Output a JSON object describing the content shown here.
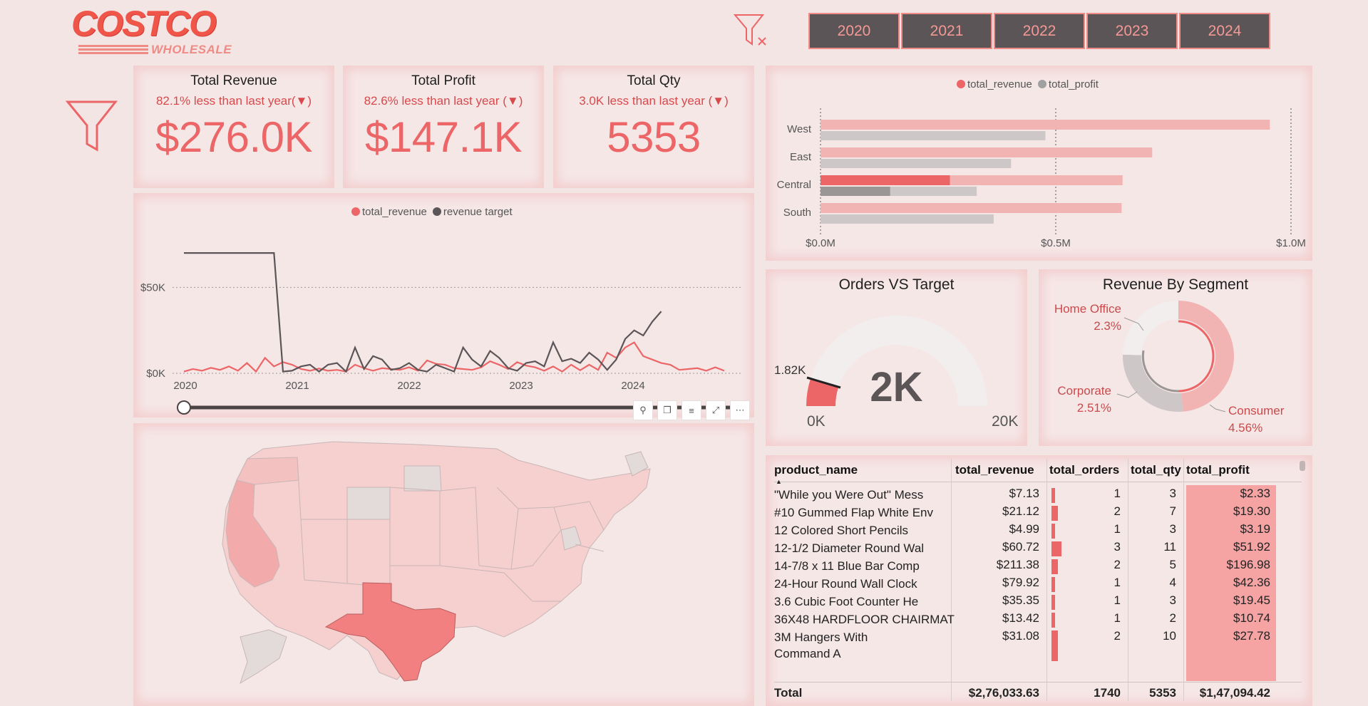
{
  "brand": {
    "name": "COSTCO",
    "sub": "WHOLESALE"
  },
  "years": [
    "2020",
    "2021",
    "2022",
    "2023",
    "2024"
  ],
  "colors": {
    "accent": "#ec6668",
    "target": "#5b5557",
    "profit": "#a0a0a0",
    "bg": "#f4e5e5"
  },
  "kpis": [
    {
      "title": "Total Revenue",
      "subtitle": "82.1% less than last year(▼)",
      "value": "$276.0K"
    },
    {
      "title": "Total Profit",
      "subtitle": "82.6% less than last year (▼)",
      "value": "$147.1K"
    },
    {
      "title": "Total Qty",
      "subtitle": "3.0K less than last year (▼)",
      "value": "5353"
    }
  ],
  "line_legend": [
    "total_revenue",
    "revenue target"
  ],
  "bar_legend": [
    "total_revenue",
    "total_profit"
  ],
  "gauge": {
    "title": "Orders VS Target",
    "value": "2K",
    "min": "0K",
    "max": "20K",
    "target": "1.82K",
    "fraction": 0.1
  },
  "donut": {
    "title": "Revenue By Segment",
    "labels": [
      {
        "name": "Home Office",
        "pct": "2.3%"
      },
      {
        "name": "Corporate",
        "pct": "2.51%"
      },
      {
        "name": "Consumer",
        "pct": "4.56%"
      }
    ]
  },
  "chart_data": [
    {
      "type": "line",
      "title": "",
      "xlabel": "",
      "ylabel": "",
      "x_ticks": [
        "2020",
        "2021",
        "2022",
        "2023",
        "2024"
      ],
      "y_ticks": [
        "$0K",
        "$50K"
      ],
      "ylim": [
        0,
        80000
      ],
      "grid": true,
      "legend": "top-center",
      "series": [
        {
          "name": "total_revenue",
          "values": [
            1000,
            2500,
            1500,
            3200,
            2000,
            4000,
            1500,
            6000,
            1000,
            9000,
            4000,
            6500,
            5000,
            2500,
            1500,
            2800,
            1500,
            2000,
            1000,
            5000,
            3000,
            1500,
            3000,
            2500,
            2000,
            3500,
            1500,
            7500,
            5500,
            5000,
            3000,
            2500,
            2000,
            3500,
            7000,
            5000,
            2500,
            6500,
            4500,
            3500,
            1500,
            4000,
            1000,
            5000,
            1800,
            5000,
            2000,
            12000,
            9000,
            15000,
            18000,
            10000,
            8000,
            6000,
            5000,
            2000,
            2500,
            3000,
            1500,
            3500,
            1500
          ]
        },
        {
          "name": "revenue target",
          "values": [
            70000,
            70000,
            70000,
            70000,
            70000,
            70000,
            70000,
            70000,
            70000,
            70000,
            70000,
            1000,
            1500,
            4000,
            5000,
            1000,
            5000,
            6000,
            1000,
            15000,
            2500,
            10000,
            8000,
            2000,
            3000,
            6000,
            2000,
            1000,
            5000,
            3000,
            1000,
            15000,
            8000,
            4000,
            13000,
            9000,
            3000,
            1500,
            6000,
            7000,
            4000,
            18000,
            7000,
            8500,
            6000,
            12000,
            8000,
            2000,
            8000,
            20000,
            25000,
            22000,
            30000,
            36000
          ]
        }
      ]
    },
    {
      "type": "bar",
      "orientation": "horizontal",
      "title": "",
      "categories": [
        "West",
        "East",
        "Central",
        "South"
      ],
      "x_ticks": [
        "$0.0M",
        "$0.5M",
        "$1.0M"
      ],
      "xlim": [
        0,
        1000000
      ],
      "legend": "top-center",
      "series": [
        {
          "name": "total_revenue",
          "values": [
            955000,
            705000,
            642000,
            640000
          ]
        },
        {
          "name": "total_profit",
          "values": [
            478000,
            405000,
            332000,
            368000
          ]
        }
      ],
      "highlight": {
        "category": "Central",
        "total_revenue": 275000,
        "total_profit": 148000
      }
    },
    {
      "type": "pie",
      "title": "Revenue By Segment",
      "categories": [
        "Consumer",
        "Corporate",
        "Home Office"
      ],
      "values": [
        4.56,
        2.51,
        2.3
      ]
    },
    {
      "type": "table",
      "columns": [
        "product_name",
        "total_revenue",
        "total_orders",
        "total_qty",
        "total_profit"
      ],
      "rows": [
        [
          "\"While you Were Out\" Mess",
          "$7.13",
          "1",
          "3",
          "$2.33"
        ],
        [
          "#10 Gummed Flap White Env",
          "$21.12",
          "2",
          "7",
          "$19.30"
        ],
        [
          "12 Colored Short Pencils",
          "$4.99",
          "1",
          "3",
          "$3.19"
        ],
        [
          "12-1/2 Diameter Round Wal",
          "$60.72",
          "3",
          "11",
          "$51.92"
        ],
        [
          "14-7/8 x 11 Blue Bar Comp",
          "$211.38",
          "2",
          "5",
          "$196.98"
        ],
        [
          "24-Hour Round Wall Clock",
          "$79.92",
          "1",
          "4",
          "$42.36"
        ],
        [
          "3.6 Cubic Foot Counter He",
          "$35.35",
          "1",
          "3",
          "$19.45"
        ],
        [
          "36X48 HARDFLOOR CHAIRMAT",
          "$13.42",
          "1",
          "2",
          "$10.74"
        ],
        [
          "3M Hangers With Command A",
          "$31.08",
          "2",
          "10",
          "$27.78"
        ]
      ],
      "total": [
        "Total",
        "$2,76,033.63",
        "1740",
        "5353",
        "$1,47,094.42"
      ]
    }
  ]
}
